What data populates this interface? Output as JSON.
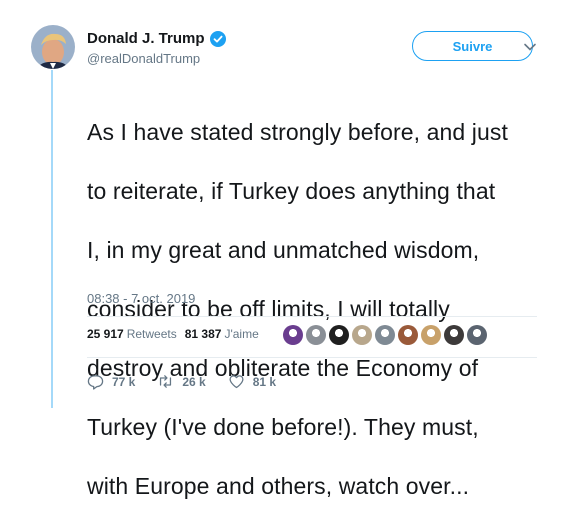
{
  "author": {
    "name": "Donald J. Trump",
    "handle": "@realDonaldTrump",
    "verified": true
  },
  "follow_button": {
    "label": "Suivre"
  },
  "tweet": {
    "lines": [
      "As I have stated strongly before, and just",
      "to reiterate, if Turkey does anything that",
      "I, in my great and unmatched wisdom,",
      "consider to be off limits, I will totally",
      "destroy and obliterate the Economy of",
      "Turkey (I've done before!). They must,",
      "with Europe and others, watch over..."
    ],
    "timestamp": "08:38 - 7 oct. 2019"
  },
  "stats": {
    "retweets_count": "25 917",
    "retweets_label": "Retweets",
    "likes_count": "81 387",
    "likes_label": "J'aime"
  },
  "likers": [
    {
      "icon": "avatar-1",
      "color": "#6a3d8f"
    },
    {
      "icon": "avatar-2",
      "color": "#8a8f96"
    },
    {
      "icon": "avatar-3",
      "color": "#1f1f1f"
    },
    {
      "icon": "avatar-4",
      "color": "#b8a78c"
    },
    {
      "icon": "avatar-5",
      "color": "#7f8a94"
    },
    {
      "icon": "avatar-6",
      "color": "#9a5a3a"
    },
    {
      "icon": "avatar-7",
      "color": "#c8a16a"
    },
    {
      "icon": "avatar-8",
      "color": "#3d3a3a"
    },
    {
      "icon": "avatar-9",
      "color": "#5b6470"
    }
  ],
  "actions": {
    "replies": "77 k",
    "retweets": "26 k",
    "likes": "81 k"
  },
  "colors": {
    "accent": "#1da1f2",
    "thread_line": "#a4d9f9",
    "secondary_text": "#657786"
  }
}
